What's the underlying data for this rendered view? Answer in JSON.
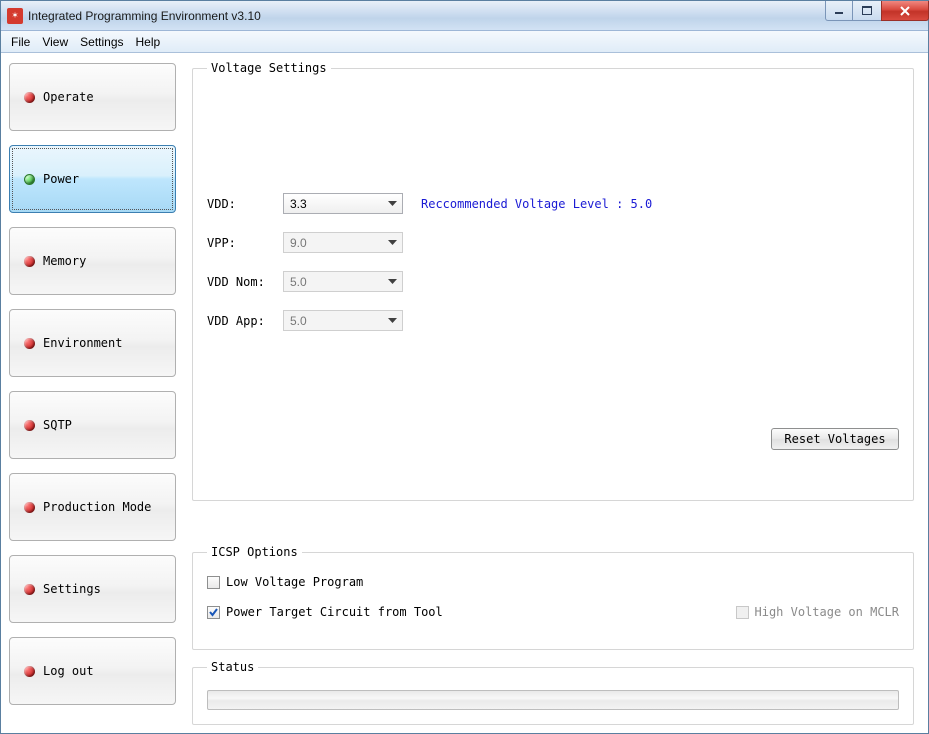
{
  "window": {
    "title": "Integrated Programming Environment v3.10"
  },
  "menu": {
    "file": "File",
    "view": "View",
    "settings": "Settings",
    "help": "Help"
  },
  "sidebar": {
    "operate": "Operate",
    "power": "Power",
    "memory": "Memory",
    "environment": "Environment",
    "sqtp": "SQTP",
    "production": "Production Mode",
    "settings": "Settings",
    "logout": "Log out"
  },
  "voltage": {
    "legend": "Voltage Settings",
    "vdd_label": "VDD:",
    "vdd_value": "3.3",
    "vdd_rec": "Reccommended Voltage Level : 5.0",
    "vpp_label": "VPP:",
    "vpp_value": "9.0",
    "vddnom_label": "VDD Nom:",
    "vddnom_value": "5.0",
    "vddapp_label": "VDD App:",
    "vddapp_value": "5.0",
    "reset": "Reset Voltages"
  },
  "icsp": {
    "legend": "ICSP Options",
    "lvp": "Low Voltage Program",
    "ptt": "Power Target Circuit from Tool",
    "hvm": "High Voltage on MCLR"
  },
  "status": {
    "legend": "Status"
  }
}
